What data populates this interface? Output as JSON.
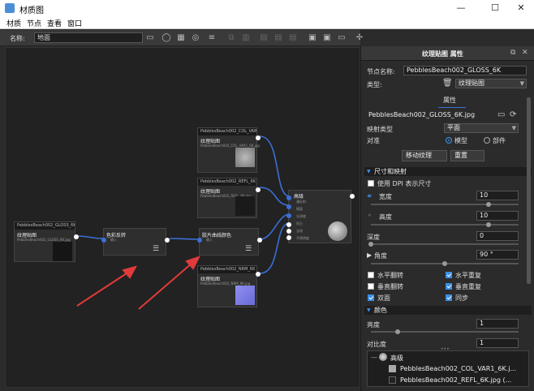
{
  "window": {
    "title": "材质图",
    "minimize": "—",
    "maximize": "☐",
    "close": "✕"
  },
  "menu": [
    "材质",
    "节点",
    "查看",
    "窗口"
  ],
  "toolbar": {
    "name_label": "名称:",
    "name_value": "地面"
  },
  "nodes": [
    {
      "id": "n1",
      "title": "PebblesBeach002_GLOSS_6K",
      "head": "纹理贴图",
      "sub": "PebblesBeach002_GLOSS_6K.jpg"
    },
    {
      "id": "n2",
      "title": "",
      "head": "色彩反转",
      "sub": "输入"
    },
    {
      "id": "n3",
      "title": "PebblesBeach002_COL_VAR1_6K",
      "head": "纹理贴图",
      "sub": "PebblesBeach002_COL_VAR1_6K.jpg"
    },
    {
      "id": "n4",
      "title": "PebblesBeach002_REFL_6K",
      "head": "纹理贴图",
      "sub": "PebblesBeach002_REFL_6K.jpg"
    },
    {
      "id": "n5",
      "title": "",
      "head": "胶片曲线颜色",
      "sub": "输入"
    },
    {
      "id": "n6",
      "title": "PebblesBeach002_NRM_6K",
      "head": "纹理贴图",
      "sub": "PebblesBeach002_NRM_6K.jpg"
    },
    {
      "id": "n7",
      "title": "",
      "head": "高级",
      "inputs": [
        "漫反射",
        "镜面",
        "光泽度",
        "凹凸",
        "法线",
        "不透明度"
      ]
    }
  ],
  "panel": {
    "header": "纹理贴图 属性",
    "node_name_label": "节点名称:",
    "node_name_value": "PebblesBeach002_GLOSS_6K",
    "type_label": "类型:",
    "type_value": "纹理贴图",
    "props_tab": "属性",
    "file_value": "PebblesBeach002_GLOSS_6K.jpg",
    "mapping_label": "映射类型",
    "mapping_value": "平面",
    "project_label": "对准",
    "radio_model": "模型",
    "radio_part": "部件",
    "move_btn": "移动纹理",
    "reset_btn": "重置",
    "size_section": "尺寸和映射",
    "dpi_label": "使用 DPI 表示尺寸",
    "width_label": "宽度",
    "width_value": "10",
    "height_label": "高度",
    "height_value": "10",
    "depth_label": "深度",
    "depth_value": "0",
    "angle_label": "角度",
    "angle_value": "90 °",
    "hflip": "水平翻转",
    "hrepeat": "水平重复",
    "vflip": "垂直翻转",
    "vrepeat": "垂直重复",
    "double": "双面",
    "sync": "同步",
    "color_section": "颜色",
    "brightness_label": "亮度",
    "brightness_value": "1",
    "contrast_label": "对比度",
    "contrast_value": "1",
    "ellipsis": "•••"
  },
  "tree": {
    "root": "高级",
    "items": [
      "PebblesBeach002_COL_VAR1_6K.j...",
      "PebblesBeach002_REFL_6K.jpg (..."
    ]
  },
  "colors": {
    "accent": "#3b6fd6",
    "arrow": "#e03a3a",
    "wire": "#3b6fd6"
  }
}
